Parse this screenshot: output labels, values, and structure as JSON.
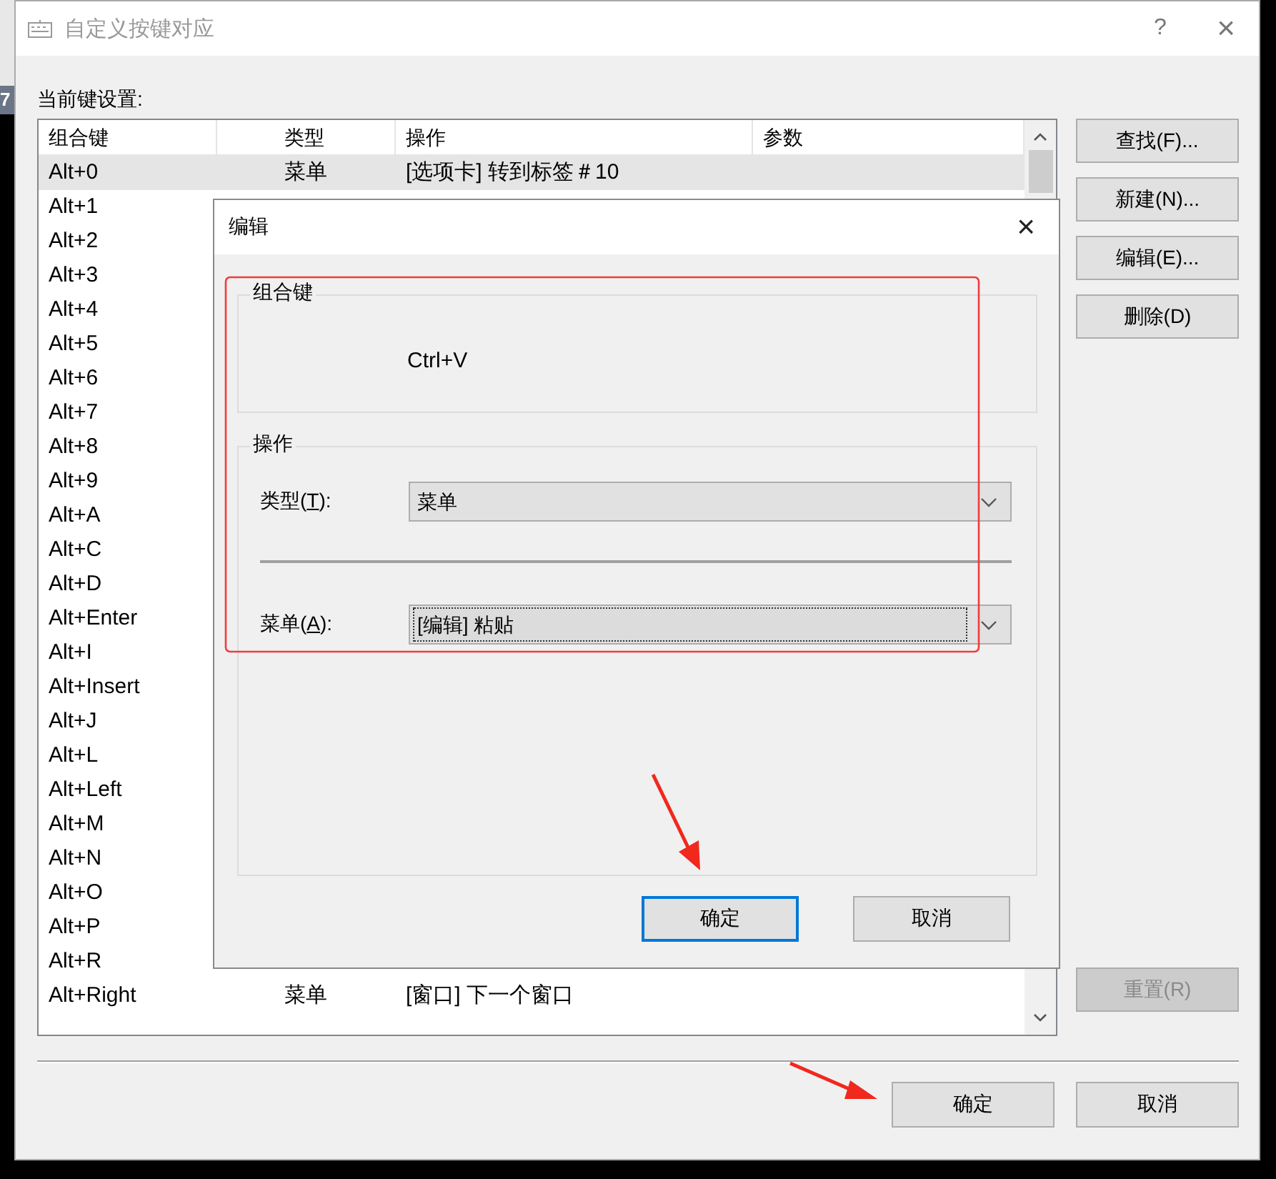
{
  "background_fragment": "7",
  "window": {
    "title": "自定义按键对应",
    "help": "?",
    "close": "×"
  },
  "list_label": "当前键设置:",
  "table": {
    "columns": [
      "组合键",
      "类型",
      "操作",
      "参数"
    ],
    "rows": [
      {
        "key": "Alt+0",
        "type": "菜单",
        "action": "[选项卡] 转到标签＃10",
        "selected": true
      },
      {
        "key": "Alt+1",
        "selected": false
      },
      {
        "key": "Alt+2",
        "selected": false
      },
      {
        "key": "Alt+3",
        "selected": false
      },
      {
        "key": "Alt+4",
        "selected": false
      },
      {
        "key": "Alt+5",
        "selected": false
      },
      {
        "key": "Alt+6",
        "selected": false
      },
      {
        "key": "Alt+7",
        "selected": false
      },
      {
        "key": "Alt+8",
        "selected": false
      },
      {
        "key": "Alt+9",
        "selected": false
      },
      {
        "key": "Alt+A",
        "selected": false
      },
      {
        "key": "Alt+C",
        "selected": false
      },
      {
        "key": "Alt+D",
        "selected": false
      },
      {
        "key": "Alt+Enter",
        "selected": false
      },
      {
        "key": "Alt+I",
        "selected": false
      },
      {
        "key": "Alt+Insert",
        "selected": false
      },
      {
        "key": "Alt+J",
        "selected": false
      },
      {
        "key": "Alt+L",
        "selected": false
      },
      {
        "key": "Alt+Left",
        "selected": false
      },
      {
        "key": "Alt+M",
        "selected": false
      },
      {
        "key": "Alt+N",
        "selected": false
      },
      {
        "key": "Alt+O",
        "selected": false
      },
      {
        "key": "Alt+P",
        "selected": false
      },
      {
        "key": "Alt+R",
        "selected": false
      },
      {
        "key": "Alt+Right",
        "type": "菜单",
        "action": "[窗口] 下一个窗口",
        "selected": false
      }
    ]
  },
  "side_buttons": [
    {
      "label": "查找(F)...",
      "disabled": false
    },
    {
      "label": "新建(N)...",
      "disabled": false
    },
    {
      "label": "编辑(E)...",
      "disabled": false
    },
    {
      "label": "删除(D)",
      "disabled": false
    }
  ],
  "reset_button": {
    "label": "重置(R)",
    "disabled": true
  },
  "footer_buttons": [
    {
      "label": "确定",
      "default": false
    },
    {
      "label": "取消",
      "default": false
    }
  ],
  "edit_dialog": {
    "title": "编辑",
    "close": "×",
    "combo_group": {
      "title": "组合键",
      "value": "Ctrl+V"
    },
    "action_group": {
      "title": "操作",
      "type_field": {
        "label": {
          "before": "类型(",
          "key": "T",
          "after": "):"
        },
        "value": "菜单",
        "focused": false
      },
      "menu_field": {
        "label": {
          "before": "菜单(",
          "key": "A",
          "after": "):"
        },
        "value": "[编辑] 粘贴",
        "focused": true
      }
    },
    "buttons": [
      {
        "label": "确定",
        "default": true
      },
      {
        "label": "取消",
        "default": false
      }
    ]
  }
}
